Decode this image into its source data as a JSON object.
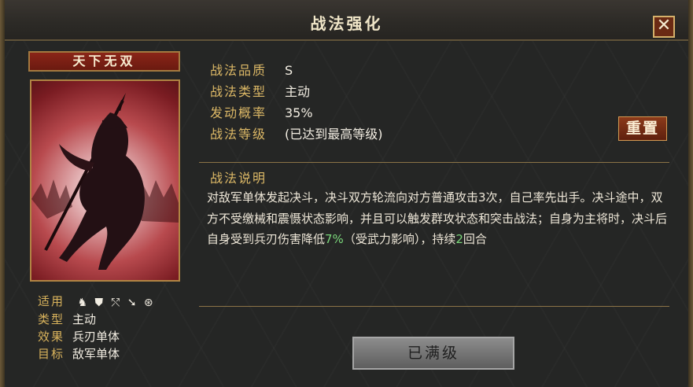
{
  "window": {
    "title": "战法强化",
    "close_label": "✕"
  },
  "skill": {
    "name": "天下无双",
    "attributes": [
      {
        "key": "适用",
        "icons": [
          "cavalry-icon",
          "shield-icon",
          "bow-icon",
          "spear-icon",
          "vehicle-icon"
        ]
      },
      {
        "key": "类型",
        "value": "主动"
      },
      {
        "key": "效果",
        "value": "兵刃单体"
      },
      {
        "key": "目标",
        "value": "敌军单体"
      }
    ]
  },
  "info": [
    {
      "key": "战法品质",
      "value": "S"
    },
    {
      "key": "战法类型",
      "value": "主动"
    },
    {
      "key": "发动概率",
      "value": "35%"
    },
    {
      "key": "战法等级",
      "value": "(已达到最高等级)"
    }
  ],
  "reset_label": "重置",
  "description": {
    "title": "战法说明",
    "part1": "对敌军单体发起决斗，决斗双方轮流向对方普通攻击3次，自己率先出手。决斗途中，双方不受缴械和震慑状态影响，并且可以触发群攻状态和突击战法；自身为主将时，决斗后自身受到兵刃伤害降低",
    "highlight1": "7%",
    "part2": "（受武力影响），持续",
    "highlight2": "2",
    "part3": "回合"
  },
  "maxed_label": "已满级",
  "colors": {
    "gold_label": "#dcb866",
    "highlight_green": "#7ad77a",
    "plate_red": "#8a2518"
  }
}
